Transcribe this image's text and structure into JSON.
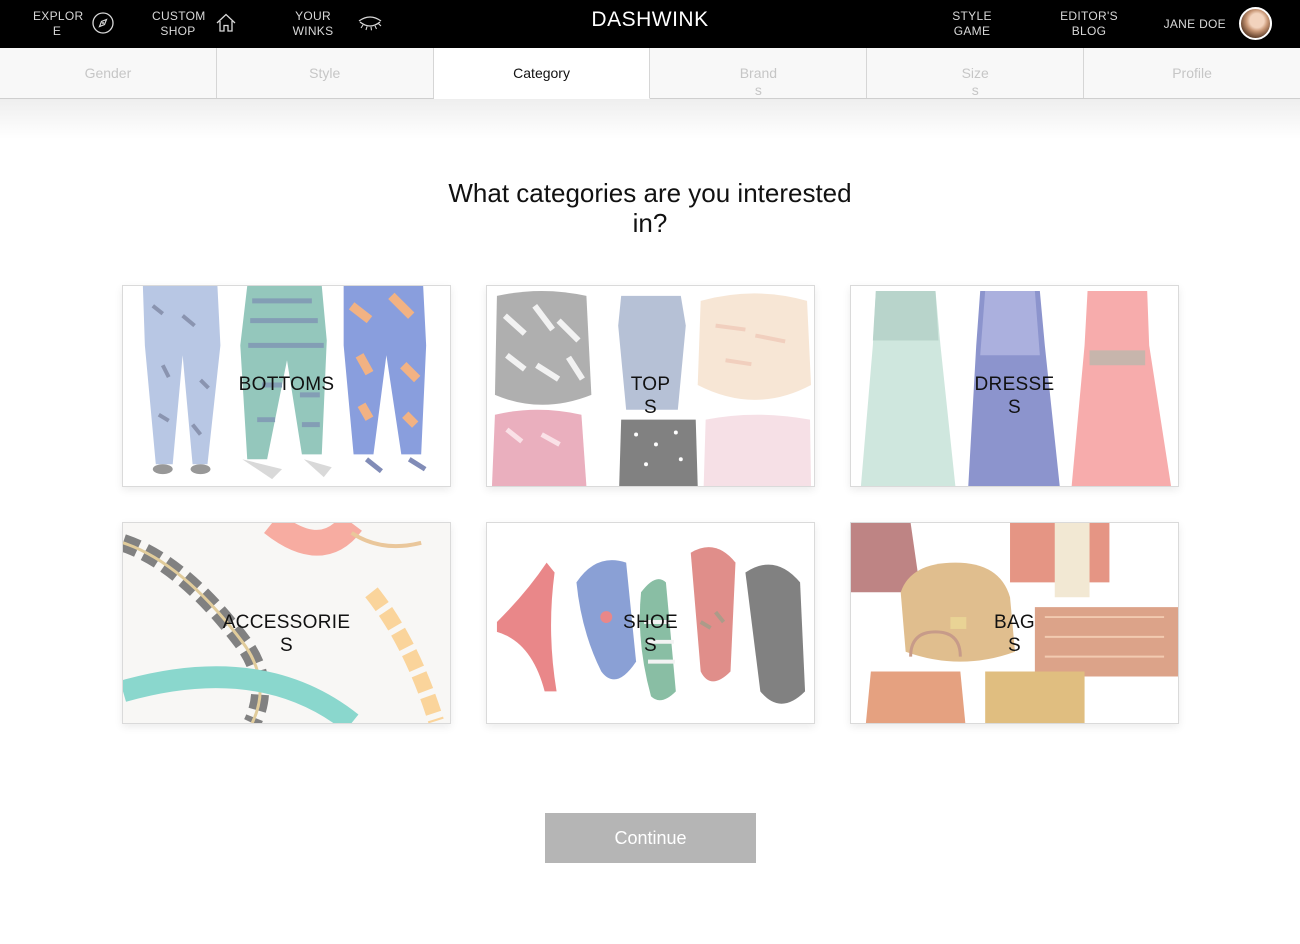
{
  "app": {
    "brand": "DASHWINK"
  },
  "nav": {
    "explore": {
      "label": "EXPLOR\nE",
      "icon": "compass-icon"
    },
    "custom_shop": {
      "label": "CUSTOM\nSHOP",
      "icon": "home-icon"
    },
    "your_winks": {
      "label": "YOUR\nWINKS",
      "icon": "eye-wink-icon"
    },
    "style_game": {
      "label": "STYLE\nGAME"
    },
    "editors_blog": {
      "label": "EDITOR'S\nBLOG"
    },
    "user": {
      "name": "JANE DOE"
    }
  },
  "steps": {
    "items": [
      {
        "label": "Gender"
      },
      {
        "label": "Style"
      },
      {
        "label": "Category"
      },
      {
        "label": "Brand\ns"
      },
      {
        "label": "Size\ns"
      },
      {
        "label": "Profile"
      }
    ],
    "active": "Category"
  },
  "main": {
    "heading": "What categories are you interested in?",
    "categories": [
      {
        "label": "BOTTOMS"
      },
      {
        "label": "TOP\nS"
      },
      {
        "label": "DRESSE\nS"
      },
      {
        "label": "ACCESSORIE\nS"
      },
      {
        "label": "SHOE\nS"
      },
      {
        "label": "BAG\nS"
      }
    ],
    "continue_label": "Continue"
  },
  "colors": {
    "topbar": "#000000",
    "continue_button": "#b5b5b5",
    "tab_inactive_text": "#c6c6c6"
  }
}
